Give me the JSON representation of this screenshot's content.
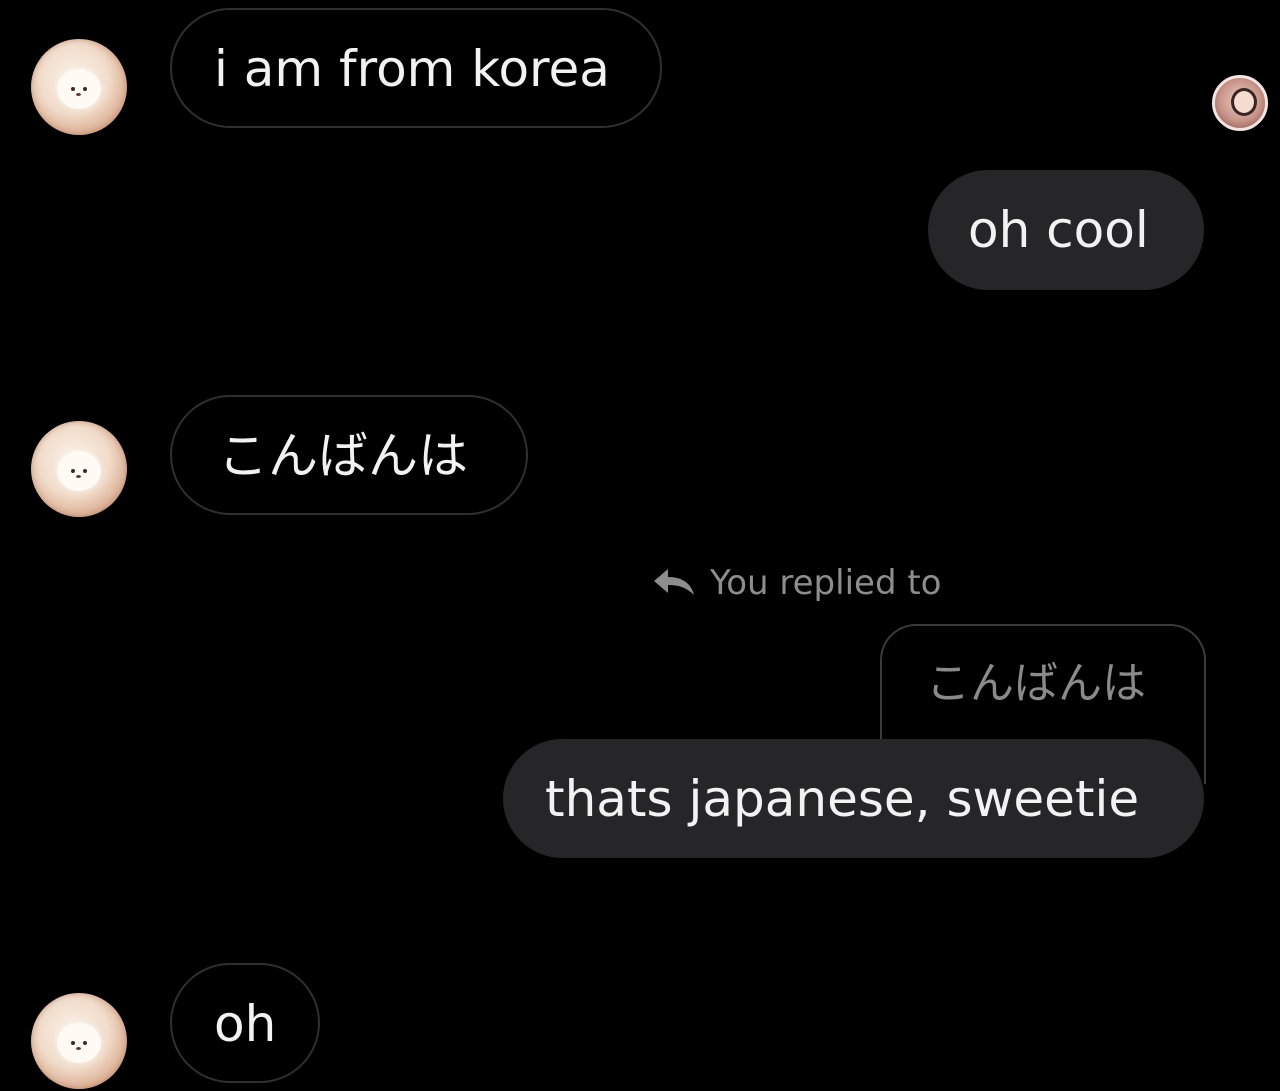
{
  "messages": [
    {
      "from": "them",
      "text": "i am from korea"
    },
    {
      "from": "me",
      "text": "oh cool"
    },
    {
      "from": "them",
      "text": "こんばんは"
    },
    {
      "from": "me",
      "text": "thats japanese, sweetie",
      "reply_label": "You replied to",
      "reply_quote": "こんばんは"
    },
    {
      "from": "them",
      "text": "oh"
    }
  ],
  "icons": {
    "reply": "reply-arrow-icon"
  },
  "colors": {
    "background": "#000000",
    "outgoing_bubble": "#262628",
    "incoming_border": "#2f2f2f",
    "muted_text": "#8d8d8d"
  }
}
